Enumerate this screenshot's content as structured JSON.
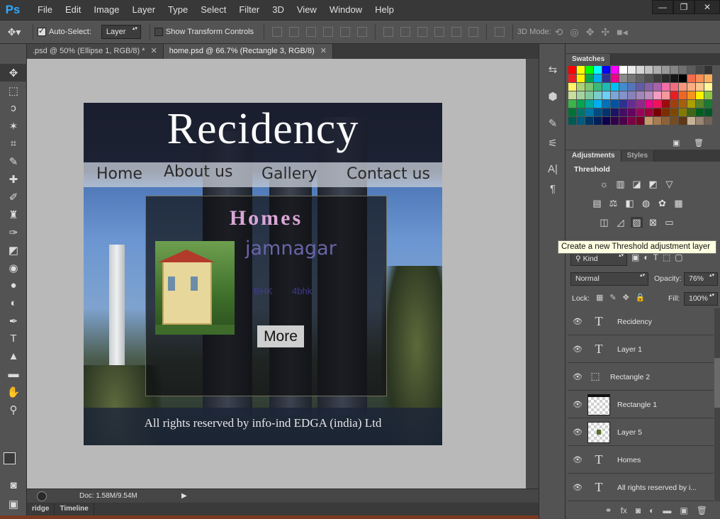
{
  "app": {
    "logo": "Ps"
  },
  "menu": [
    "File",
    "Edit",
    "Image",
    "Layer",
    "Type",
    "Select",
    "Filter",
    "3D",
    "View",
    "Window",
    "Help"
  ],
  "window_controls": {
    "minimize": "—",
    "restore": "❐",
    "close": "✕"
  },
  "options_bar": {
    "auto_select_label": "Auto-Select:",
    "auto_select_checked": true,
    "auto_select_target": "Layer",
    "show_transform_label": "Show Transform Controls",
    "show_transform_checked": false,
    "mode_3d_label": "3D Mode:"
  },
  "doc_tabs": [
    {
      "label": ".psd @ 50% (Ellipse 1, RGB/8) *",
      "close": "✕",
      "active": false
    },
    {
      "label": "home.psd @ 66.7% (Rectangle 3, RGB/8)",
      "close": "✕",
      "active": true
    }
  ],
  "status_bar": {
    "doc_size": "Doc: 1.58M/9.54M"
  },
  "bottom_tabs": [
    "ridge",
    "Timeline"
  ],
  "canvas": {
    "site_title": "Recidency",
    "nav": [
      "Home",
      "About us",
      "Gallery",
      "Contact us"
    ],
    "section_title": "Homes",
    "city": "jamnagar",
    "bhk_label": "BHK",
    "bhk_value": "4bhk",
    "more_button": "More",
    "footer": "All rights reserved by  info-ind EDGA (india) Ltd"
  },
  "swatches_panel": {
    "title": "Swatches"
  },
  "adjustments_panel": {
    "tabs": [
      "Adjustments",
      "Styles"
    ],
    "current": "Threshold",
    "tooltip": "Create a new Threshold adjustment layer"
  },
  "layers_panel": {
    "filter_kind": "Kind",
    "blend_mode": "Normal",
    "opacity_label": "Opacity:",
    "opacity_value": "76%",
    "lock_label": "Lock:",
    "fill_label": "Fill:",
    "fill_value": "100%",
    "layers": [
      {
        "name": "Recidency",
        "kind": "text"
      },
      {
        "name": "Layer 1",
        "kind": "text"
      },
      {
        "name": "Rectangle 2",
        "kind": "shape"
      },
      {
        "name": "Rectangle 1",
        "kind": "pixel"
      },
      {
        "name": "Layer 5",
        "kind": "pixel"
      },
      {
        "name": "Homes",
        "kind": "text"
      },
      {
        "name": "All rights reserved by  i...",
        "kind": "text"
      }
    ]
  },
  "colors": {
    "ps_blue": "#31a8ff",
    "foreground": "#3a3a3a",
    "background": "#f5c48a"
  }
}
